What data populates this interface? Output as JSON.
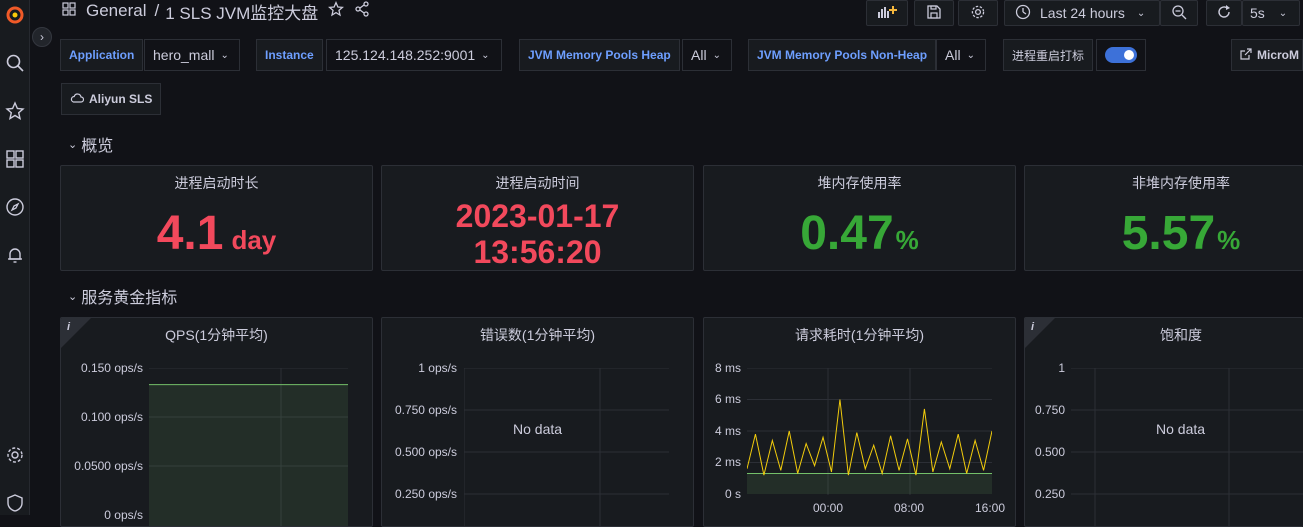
{
  "breadcrumb": {
    "folder": "General",
    "separator": "/",
    "dashboard": "1 SLS JVM监控大盘"
  },
  "toolbar": {
    "time_range": "Last 24 hours",
    "refresh_interval": "5s"
  },
  "variables": [
    {
      "label": "Application",
      "value": "hero_mall"
    },
    {
      "label": "Instance",
      "value": "125.124.148.252:9001"
    },
    {
      "label": "JVM Memory Pools Heap",
      "value": "All"
    },
    {
      "label": "JVM Memory Pools Non-Heap",
      "value": "All"
    }
  ],
  "toggle": {
    "label": "进程重启打标",
    "on": true
  },
  "links": {
    "micrometer": "MicroM",
    "aliyun": "Aliyun SLS"
  },
  "rows": {
    "overview": "概览",
    "golden": "服务黄金指标"
  },
  "stats": [
    {
      "title": "进程启动时长",
      "value": "4.1",
      "unit": "day",
      "color": "#f2495c"
    },
    {
      "title": "进程启动时间",
      "line1": "2023-01-17",
      "line2": "13:56:20",
      "color": "#f2495c"
    },
    {
      "title": "堆内存使用率",
      "value": "0.47",
      "unit": "%",
      "color": "#37a837"
    },
    {
      "title": "非堆内存使用率",
      "value": "5.57",
      "unit": "%",
      "color": "#37a837"
    }
  ],
  "graphs": {
    "qps": {
      "title": "QPS(1分钟平均)",
      "yticks": [
        "0.150 ops/s",
        "0.100 ops/s",
        "0.0500 ops/s",
        "0 ops/s"
      ]
    },
    "errors": {
      "title": "错误数(1分钟平均)",
      "yticks": [
        "1 ops/s",
        "0.750 ops/s",
        "0.500 ops/s",
        "0.250 ops/s"
      ],
      "nodata": "No data"
    },
    "latency": {
      "title": "请求耗时(1分钟平均)",
      "yticks": [
        "8 ms",
        "6 ms",
        "4 ms",
        "2 ms",
        "0 s"
      ],
      "xticks": [
        "00:00",
        "08:00",
        "16:00"
      ]
    },
    "saturation": {
      "title": "饱和度",
      "yticks": [
        "1",
        "0.750",
        "0.500",
        "0.250"
      ],
      "nodata": "No data"
    }
  },
  "chart_data": [
    {
      "type": "area",
      "title": "QPS(1分钟平均)",
      "ylim": [
        0,
        0.15
      ],
      "series": [
        {
          "values": [
            0.133,
            0.133,
            0.133,
            0.133
          ]
        }
      ]
    },
    {
      "type": "line",
      "title": "错误数(1分钟平均)",
      "ylim": [
        0,
        1
      ],
      "series": []
    },
    {
      "type": "line",
      "title": "请求耗时(1分钟平均)",
      "ylim": [
        0,
        8
      ],
      "x": [
        "00:00",
        "08:00",
        "16:00"
      ],
      "series": [
        {
          "values": [
            1.6,
            3.8,
            1.2,
            3.4,
            1.5,
            4.0,
            1.3,
            3.2,
            1.8,
            3.6,
            1.4,
            6.0,
            1.2,
            3.9,
            1.6,
            3.1,
            1.3,
            3.7,
            1.5,
            3.5,
            1.2,
            5.4,
            1.4,
            3.3,
            1.6,
            3.8,
            1.3,
            3.4,
            1.5,
            4.0
          ]
        },
        {
          "values": [
            1.3,
            1.3,
            1.3,
            1.3,
            1.3,
            1.3,
            1.3,
            1.3,
            1.3,
            1.3
          ]
        }
      ]
    },
    {
      "type": "line",
      "title": "饱和度",
      "ylim": [
        0,
        1
      ],
      "series": []
    }
  ]
}
